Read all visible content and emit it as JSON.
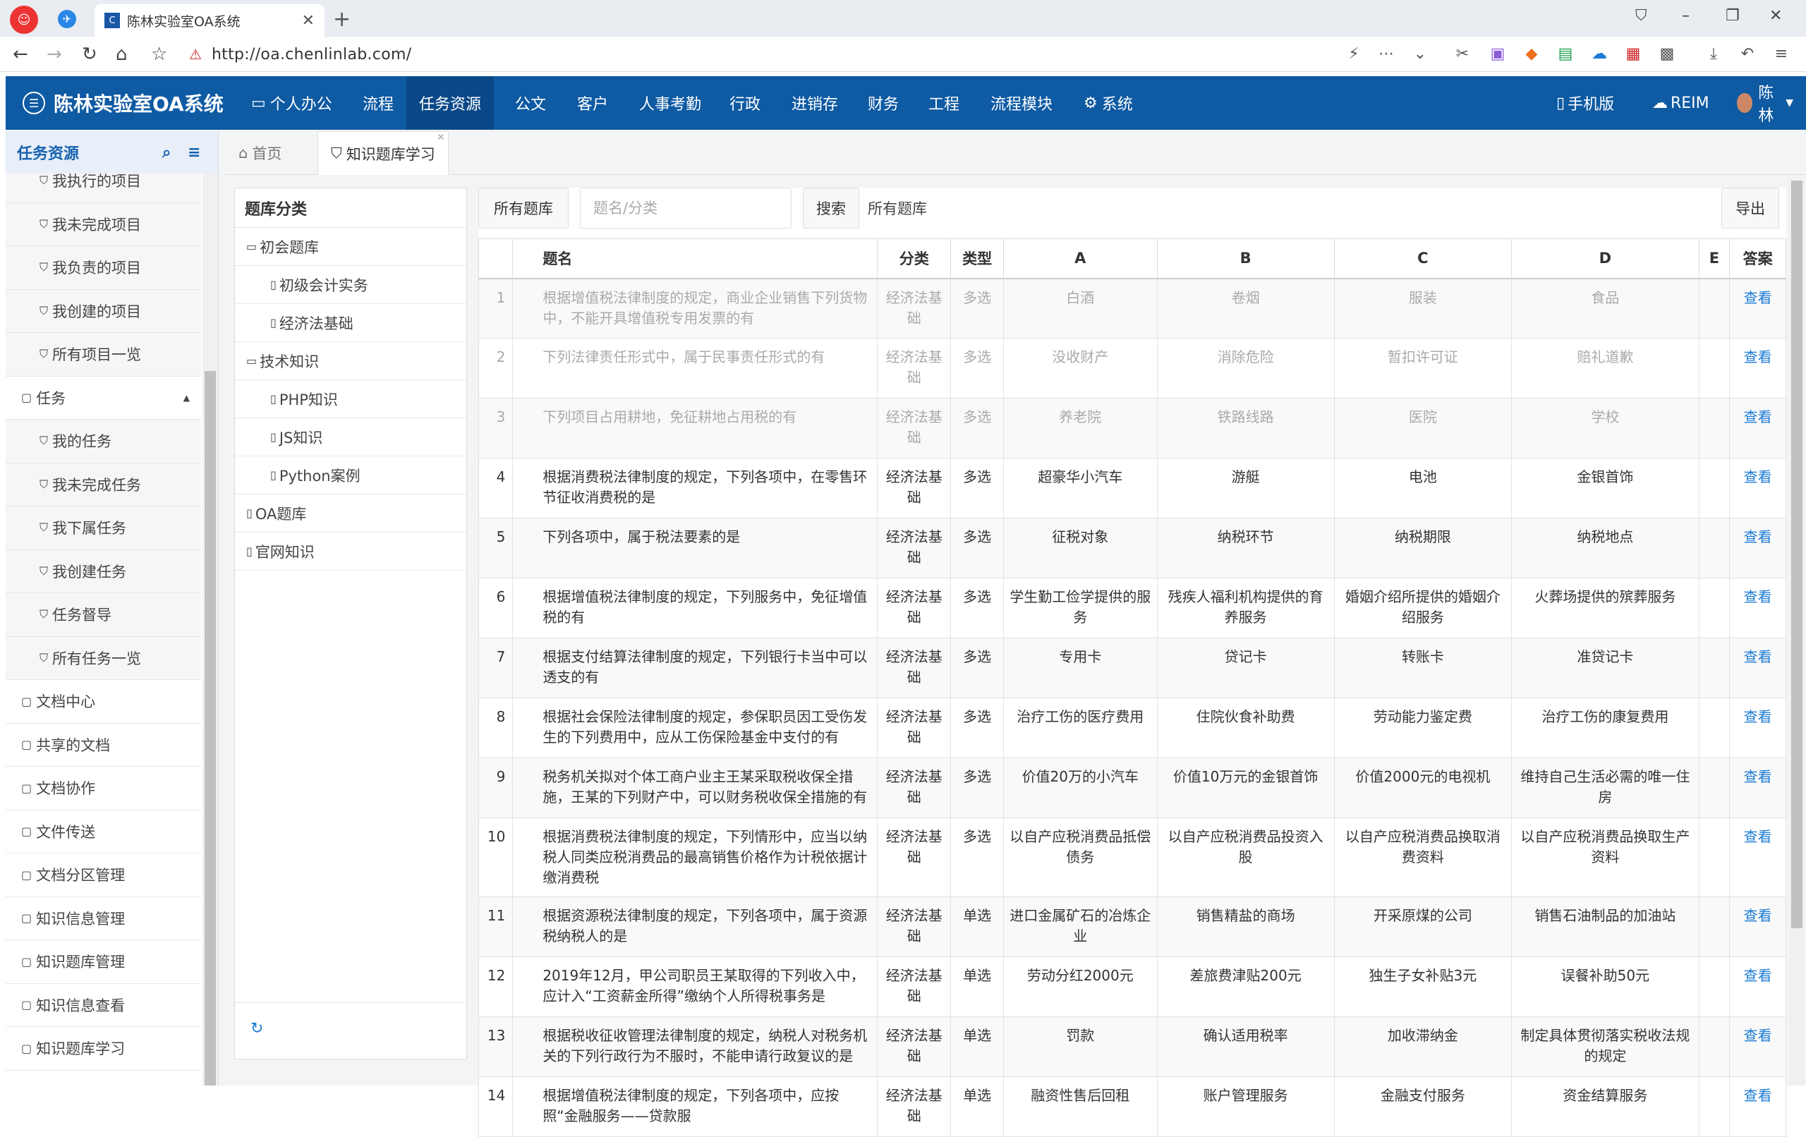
{
  "browser": {
    "tab_title": "陈林实验室OA系统",
    "url": "http://oa.chenlinlab.com/"
  },
  "app": {
    "title": "陈林实验室OA系统",
    "right": {
      "mobile": "手机版",
      "reim": "REIM",
      "user": "陈林"
    }
  },
  "nav": [
    "个人办公",
    "流程",
    "任务资源",
    "公文",
    "客户",
    "人事考勤",
    "行政",
    "进销存",
    "财务",
    "工程",
    "流程模块",
    "系统"
  ],
  "sidebar": {
    "title": "任务资源",
    "items": [
      {
        "label": "我执行的项目",
        "level": 2
      },
      {
        "label": "我未完成项目",
        "level": 2
      },
      {
        "label": "我负责的项目",
        "level": 2
      },
      {
        "label": "我创建的项目",
        "level": 2
      },
      {
        "label": "所有项目一览",
        "level": 2
      },
      {
        "label": "任务",
        "level": 1
      },
      {
        "label": "我的任务",
        "level": 2
      },
      {
        "label": "我未完成任务",
        "level": 2
      },
      {
        "label": "我下属任务",
        "level": 2
      },
      {
        "label": "我创建任务",
        "level": 2
      },
      {
        "label": "任务督导",
        "level": 2
      },
      {
        "label": "所有任务一览",
        "level": 2
      },
      {
        "label": "文档中心",
        "level": 1
      },
      {
        "label": "共享的文档",
        "level": 1
      },
      {
        "label": "文档协作",
        "level": 1
      },
      {
        "label": "文件传送",
        "level": 1
      },
      {
        "label": "文档分区管理",
        "level": 1
      },
      {
        "label": "知识信息管理",
        "level": 1
      },
      {
        "label": "知识题库管理",
        "level": 1
      },
      {
        "label": "知识信息查看",
        "level": 1
      },
      {
        "label": "知识题库学习",
        "level": 1
      }
    ]
  },
  "page_tabs": {
    "home": "首页",
    "current": "知识题库学习"
  },
  "tree": {
    "title": "题库分类",
    "nodes": [
      {
        "label": "初会题库",
        "level": 1,
        "icon": "folder"
      },
      {
        "label": "初级会计实务",
        "level": 2,
        "icon": "file"
      },
      {
        "label": "经济法基础",
        "level": 2,
        "icon": "file"
      },
      {
        "label": "技术知识",
        "level": 1,
        "icon": "folder"
      },
      {
        "label": "PHP知识",
        "level": 2,
        "icon": "file"
      },
      {
        "label": "JS知识",
        "level": 2,
        "icon": "file"
      },
      {
        "label": "Python案例",
        "level": 2,
        "icon": "file"
      },
      {
        "label": "OA题库",
        "level": 1,
        "icon": "file"
      },
      {
        "label": "官网知识",
        "level": 1,
        "icon": "file"
      }
    ]
  },
  "toolbar": {
    "all_btn": "所有题库",
    "search_placeholder": "题名/分类",
    "search_btn": "搜索",
    "current_bank": "所有题库",
    "export_btn": "导出"
  },
  "table": {
    "headers": [
      "",
      "题名",
      "分类",
      "类型",
      "A",
      "B",
      "C",
      "D",
      "E",
      "答案"
    ],
    "rows": [
      {
        "n": "1",
        "title": "根据增值税法律制度的规定，商业企业销售下列货物中，不能开具增值税专用发票的有",
        "cat": "经济法基础",
        "type": "多选",
        "a": "白酒",
        "b": "卷烟",
        "c": "服装",
        "d": "食品",
        "e": "",
        "ans": "查看",
        "dim": true
      },
      {
        "n": "2",
        "title": "下列法律责任形式中，属于民事责任形式的有",
        "cat": "经济法基础",
        "type": "多选",
        "a": "没收财产",
        "b": "消除危险",
        "c": "暂扣许可证",
        "d": "赔礼道歉",
        "e": "",
        "ans": "查看",
        "dim": true
      },
      {
        "n": "3",
        "title": "下列项目占用耕地，免征耕地占用税的有",
        "cat": "经济法基础",
        "type": "多选",
        "a": "养老院",
        "b": "铁路线路",
        "c": "医院",
        "d": "学校",
        "e": "",
        "ans": "查看",
        "dim": true
      },
      {
        "n": "4",
        "title": "根据消费税法律制度的规定，下列各项中，在零售环节征收消费税的是",
        "cat": "经济法基础",
        "type": "多选",
        "a": "超豪华小汽车",
        "b": "游艇",
        "c": "电池",
        "d": "金银首饰",
        "e": "",
        "ans": "查看",
        "dim": false
      },
      {
        "n": "5",
        "title": "下列各项中，属于税法要素的是",
        "cat": "经济法基础",
        "type": "多选",
        "a": "征税对象",
        "b": "纳税环节",
        "c": "纳税期限",
        "d": "纳税地点",
        "e": "",
        "ans": "查看",
        "dim": false
      },
      {
        "n": "6",
        "title": "根据增值税法律制度的规定，下列服务中，免征增值税的有",
        "cat": "经济法基础",
        "type": "多选",
        "a": "学生勤工俭学提供的服务",
        "b": "残疾人福利机构提供的育养服务",
        "c": "婚姻介绍所提供的婚姻介绍服务",
        "d": "火葬场提供的殡葬服务",
        "e": "",
        "ans": "查看",
        "dim": false
      },
      {
        "n": "7",
        "title": "根据支付结算法律制度的规定，下列银行卡当中可以透支的有",
        "cat": "经济法基础",
        "type": "多选",
        "a": "专用卡",
        "b": "贷记卡",
        "c": "转账卡",
        "d": "准贷记卡",
        "e": "",
        "ans": "查看",
        "dim": false
      },
      {
        "n": "8",
        "title": "根据社会保险法律制度的规定，参保职员因工受伤发生的下列费用中，应从工伤保险基金中支付的有",
        "cat": "经济法基础",
        "type": "多选",
        "a": "治疗工伤的医疗费用",
        "b": "住院伙食补助费",
        "c": "劳动能力鉴定费",
        "d": "治疗工伤的康复费用",
        "e": "",
        "ans": "查看",
        "dim": false
      },
      {
        "n": "9",
        "title": "税务机关拟对个体工商户业主王某采取税收保全措施，王某的下列财产中，可以财务税收保全措施的有",
        "cat": "经济法基础",
        "type": "多选",
        "a": "价值20万的小汽车",
        "b": "价值10万元的金银首饰",
        "c": "价值2000元的电视机",
        "d": "维持自己生活必需的唯一住房",
        "e": "",
        "ans": "查看",
        "dim": false
      },
      {
        "n": "10",
        "title": "根据消费税法律制度的规定，下列情形中，应当以纳税人同类应税消费品的最高销售价格作为计税依据计缴消费税",
        "cat": "经济法基础",
        "type": "多选",
        "a": "以自产应税消费品抵偿债务",
        "b": "以自产应税消费品投资入股",
        "c": "以自产应税消费品换取消费资料",
        "d": "以自产应税消费品换取生产资料",
        "e": "",
        "ans": "查看",
        "dim": false
      },
      {
        "n": "11",
        "title": "根据资源税法律制度的规定，下列各项中，属于资源税纳税人的是",
        "cat": "经济法基础",
        "type": "单选",
        "a": "进口金属矿石的冶炼企业",
        "b": "销售精盐的商场",
        "c": "开采原煤的公司",
        "d": "销售石油制品的加油站",
        "e": "",
        "ans": "查看",
        "dim": false
      },
      {
        "n": "12",
        "title": "2019年12月，甲公司职员王某取得的下列收入中，应计入“工资薪金所得”缴纳个人所得税事务是",
        "cat": "经济法基础",
        "type": "单选",
        "a": "劳动分红2000元",
        "b": "差旅费津贴200元",
        "c": "独生子女补贴3元",
        "d": "误餐补助50元",
        "e": "",
        "ans": "查看",
        "dim": false
      },
      {
        "n": "13",
        "title": "根据税收征收管理法律制度的规定，纳税人对税务机关的下列行政行为不服时，不能申请行政复议的是",
        "cat": "经济法基础",
        "type": "单选",
        "a": "罚款",
        "b": "确认适用税率",
        "c": "加收滞纳金",
        "d": "制定具体贯彻落实税收法规的规定",
        "e": "",
        "ans": "查看",
        "dim": false
      },
      {
        "n": "14",
        "title": "根据增值税法律制度的规定，下列各项中，应按照“金融服务——贷款服",
        "cat": "经济法基础",
        "type": "单选",
        "a": "融资性售后回租",
        "b": "账户管理服务",
        "c": "金融支付服务",
        "d": "资金结算服务",
        "e": "",
        "ans": "查看",
        "dim": false
      }
    ]
  }
}
